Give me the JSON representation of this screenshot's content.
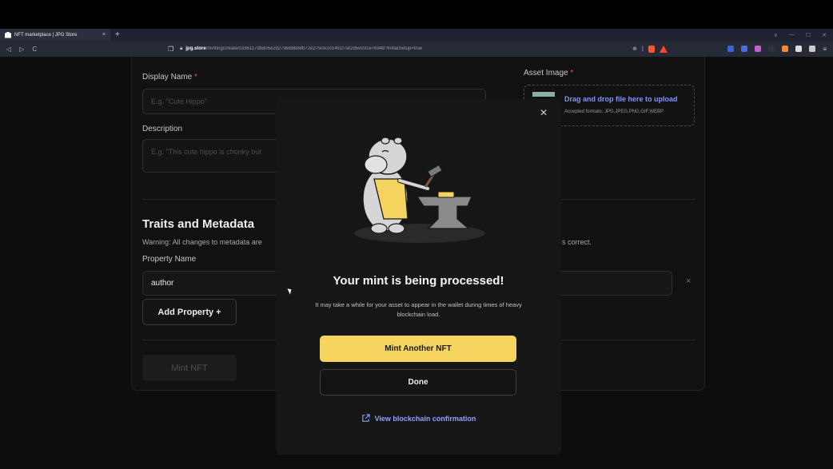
{
  "browser": {
    "tab_title": "NFT marketplace | JPG Store",
    "tab_close": "×",
    "new_tab": "+",
    "url_host": "jpg.store",
    "url_path": "/minting/create/c336117dbd05e2d279ebbb88b72e2750e101491f7af2d5e931e7694b?initialSetup=true",
    "nav": {
      "back": "◁",
      "forward": "▷",
      "reload": "C"
    },
    "window_controls": [
      "∨",
      "—",
      "☐",
      "✕"
    ]
  },
  "form": {
    "display_name_label": "Display Name",
    "required_mark": "*",
    "display_name_placeholder": "E.g. \"Cute Hippo\"",
    "description_label": "Description",
    "description_placeholder": "E.g. \"This cute hippo is chonky but",
    "asset_image_label": "Asset Image",
    "upload_title": "Drag and drop file here to upload",
    "upload_formats": "Accepted formats: JPG,JPEG,PNG,GIF,WEBP",
    "traits_title": "Traits and Metadata",
    "warning_left": "Warning: All changes to metadata are",
    "warning_right": "s correct.",
    "property_name_label": "Property Name",
    "property_name_value": "author",
    "remove_icon": "×",
    "add_property_label": "Add Property +",
    "mint_button_label": "Mint NFT"
  },
  "modal": {
    "close_icon": "✕",
    "title": "Your mint is being processed!",
    "description": "It may take a while for your asset to appear in the wallet during times of heavy blockchain load.",
    "primary_button": "Mint Another NFT",
    "secondary_button": "Done",
    "link_label": "View blockchain confirmation"
  },
  "colors": {
    "accent_yellow": "#f4d35e",
    "link_blue": "#8fa2ff",
    "required_red": "#e2574c"
  }
}
